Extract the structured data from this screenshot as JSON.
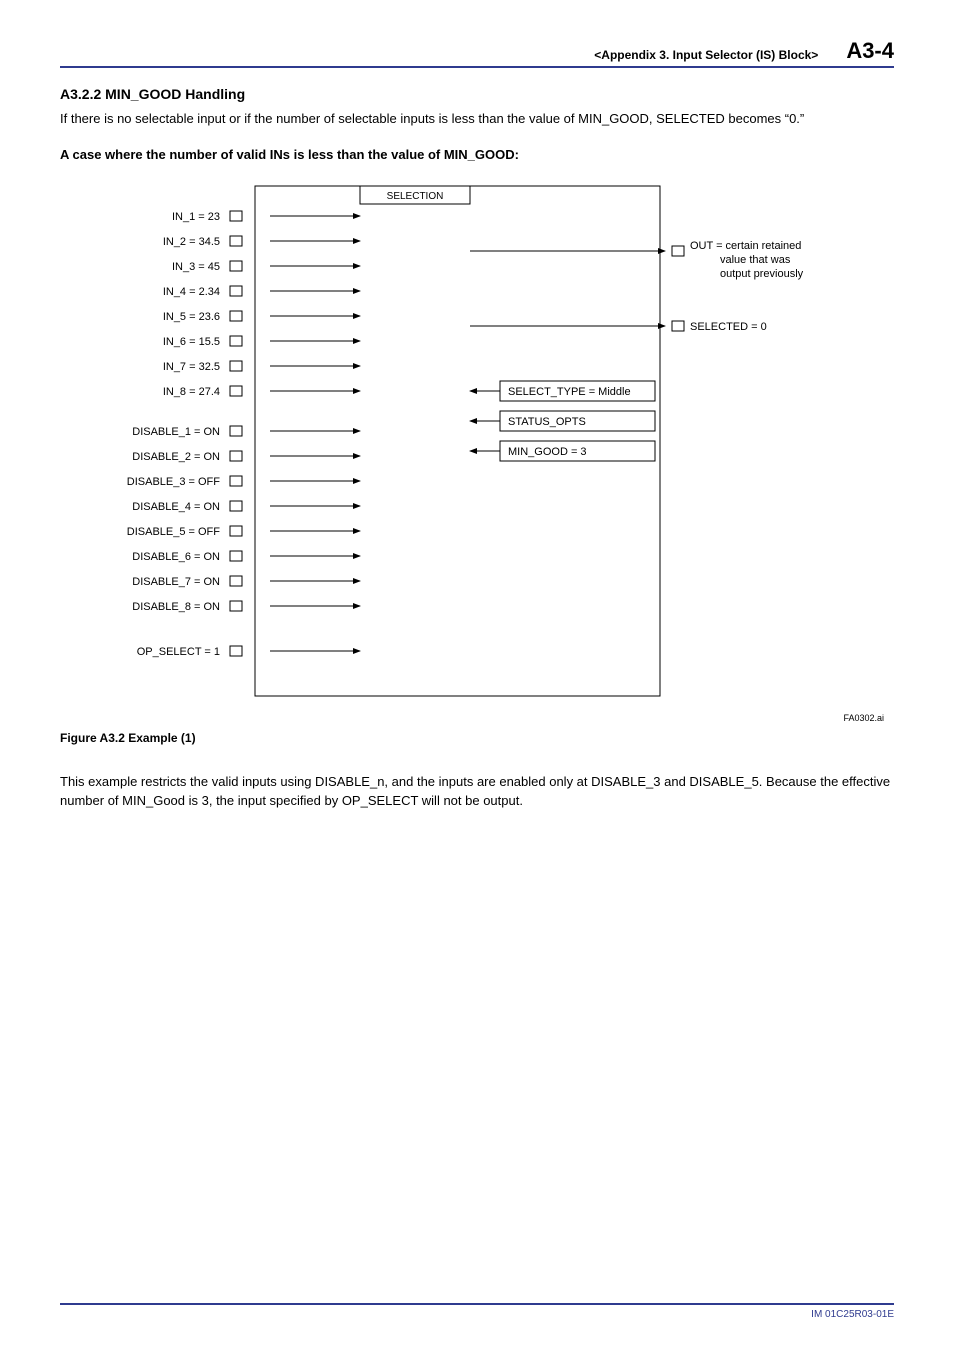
{
  "header": {
    "section_title": "<Appendix 3.  Input Selector (IS) Block>",
    "page_number": "A3-4"
  },
  "section": {
    "number_title": "A3.2.2   MIN_GOOD Handling",
    "intro": "If there is no selectable input or if the number of selectable inputs is less than the value of MIN_GOOD, SELECTED becomes “0.”",
    "case_title": "A case where the number of valid INs is less than the value of MIN_GOOD:"
  },
  "diagram": {
    "selection_label": "SELECTION",
    "inputs": [
      "IN_1 = 23",
      "IN_2 = 34.5",
      "IN_3 = 45",
      "IN_4 = 2.34",
      "IN_5 = 23.6",
      "IN_6 = 15.5",
      "IN_7 = 32.5",
      "IN_8 = 27.4"
    ],
    "disables": [
      "DISABLE_1 = ON",
      "DISABLE_2 = ON",
      "DISABLE_3 = OFF",
      "DISABLE_4 = ON",
      "DISABLE_5 = OFF",
      "DISABLE_6 = ON",
      "DISABLE_7 = ON",
      "DISABLE_8 = ON"
    ],
    "op_select": "OP_SELECT = 1",
    "out_lines": [
      "OUT = certain retained",
      "value that was",
      "output previously"
    ],
    "selected": "SELECTED = 0",
    "params": [
      "SELECT_TYPE = Middle",
      "STATUS_OPTS",
      "MIN_GOOD = 3"
    ],
    "fa_code": "FA0302.ai"
  },
  "figure_caption": "Figure A3.2    Example (1)",
  "closing": "This example restricts the valid inputs using DISABLE_n, and the inputs are enabled only at DISABLE_3 and DISABLE_5. Because the effective number of MIN_Good is 3, the input specified by OP_SELECT will not be output.",
  "footer": {
    "doc_code": "IM 01C25R03-01E"
  }
}
